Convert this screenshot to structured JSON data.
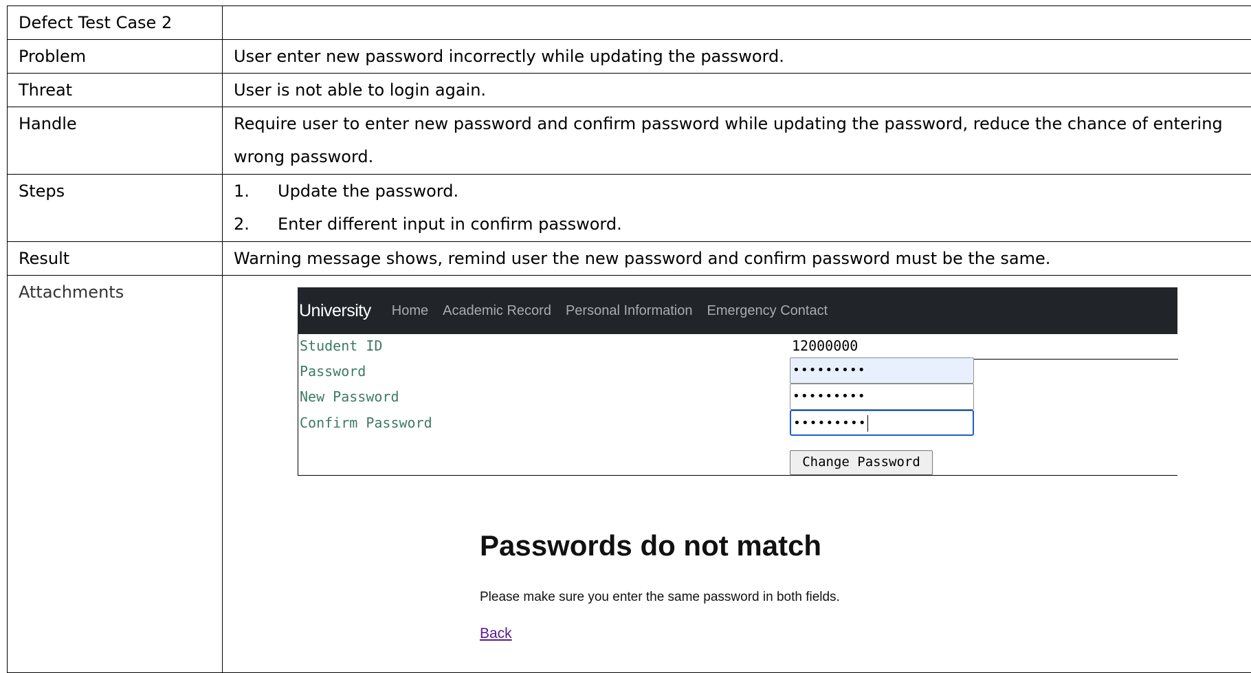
{
  "table": {
    "title_label": "Defect Test Case 2",
    "title_value": "",
    "problem_label": "Problem",
    "problem_value": "User enter new password incorrectly while updating the password.",
    "threat_label": "Threat",
    "threat_value": "User is not able to login again.",
    "handle_label": "Handle",
    "handle_value": "Require user to enter new password and confirm password while updating the password, reduce the chance of entering wrong password.",
    "steps_label": "Steps",
    "steps": [
      {
        "num": "1.",
        "text": "Update the password."
      },
      {
        "num": "2.",
        "text": "Enter different input in confirm password."
      }
    ],
    "result_label": "Result",
    "result_value": "Warning message shows, remind user the new password and confirm password must be the same.",
    "attachments_label": "Attachments"
  },
  "attachment": {
    "navbar": {
      "brand": "University",
      "links": [
        "Home",
        "Academic Record",
        "Personal Information",
        "Emergency Contact"
      ]
    },
    "form": {
      "student_id_label": "Student ID",
      "student_id_value": "12000000",
      "password_label": "Password",
      "password_value": "•••••••••",
      "new_password_label": "New Password",
      "new_password_value": "•••••••••",
      "confirm_password_label": "Confirm Password",
      "confirm_password_value": "•••••••••",
      "submit_label": "Change Password"
    },
    "error": {
      "title": "Passwords do not match",
      "message": "Please make sure you enter the same password in both fields.",
      "back_link": "Back"
    },
    "colors": {
      "navbar_bg": "#212529",
      "label_green": "#3d7a64",
      "link_visited": "#551a8b",
      "focus_border": "#1a5fc1",
      "autofill_bg": "#e8f0fe"
    }
  }
}
